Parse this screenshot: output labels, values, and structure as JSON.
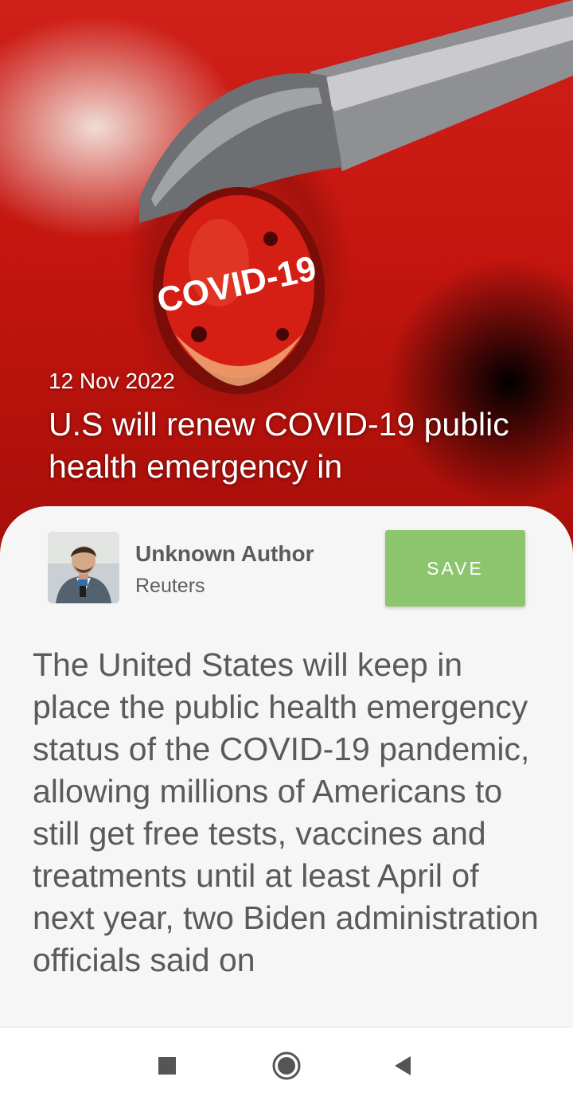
{
  "article": {
    "date": "12 Nov 2022",
    "title": "U.S will renew COVID-19 public health emergency in",
    "image_label": "COVID-19",
    "author": {
      "name": "Unknown Author",
      "source": "Reuters"
    },
    "save_label": "SAVE",
    "body": "The United States will keep in place the public health emergency status of the COVID-19 pandemic, allowing millions of Americans to still get free tests, vaccines and treatments until at least April of next year, two Biden administration officials said on"
  },
  "nav": {
    "recent_icon": "square-icon",
    "home_icon": "circle-icon",
    "back_icon": "triangle-icon"
  },
  "colors": {
    "save_button": "#8dc56f",
    "sheet_background": "#f6f6f7",
    "hero_red": "#c4150f"
  }
}
